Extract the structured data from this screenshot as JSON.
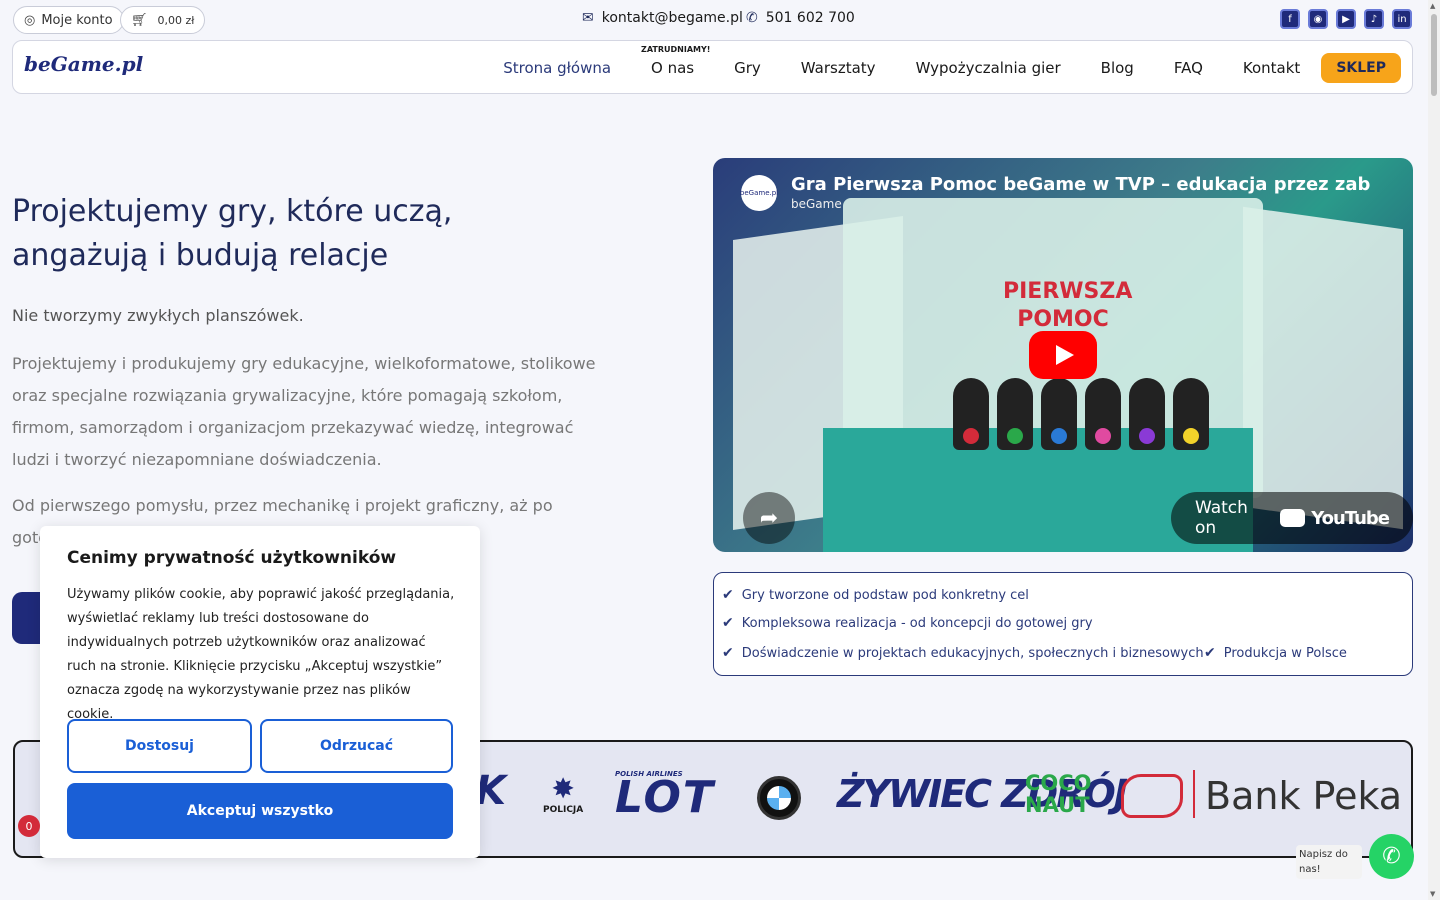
{
  "topbar": {
    "account_label": "Moje konto",
    "cart_label": "0,00 zł",
    "email": "kontakt@begame.pl",
    "phone": "501 602 700",
    "socials": [
      "facebook-icon",
      "instagram-icon",
      "youtube-icon",
      "tiktok-icon",
      "linkedin-icon"
    ]
  },
  "nav": {
    "logo": "beGame.pl",
    "items": [
      {
        "label": "Strona główna"
      },
      {
        "label": "O nas",
        "badge": "ZATRUDNIAMY!"
      },
      {
        "label": "Gry"
      },
      {
        "label": "Warsztaty"
      },
      {
        "label": "Wypożyczalnia gier"
      },
      {
        "label": "Blog"
      },
      {
        "label": "FAQ"
      },
      {
        "label": "Kontakt"
      }
    ],
    "shop_label": "SKLEP"
  },
  "hero": {
    "title": "Projektujemy gry, które uczą, angażują i budują relacje",
    "lead": "Nie tworzymy zwykłych planszówek.",
    "paragraph": "Projektujemy i produkujemy gry edukacyjne, wielkoformatowe, stolikowe oraz specjalne rozwiązania grywalizacyjne, które pomagają szkołom, firmom, samorządom i organizacjom przekazywać wiedzę, integrować ludzi i tworzyć niezapomniane doświadczenia.",
    "paragraph2": "Od pierwszego pomysłu, przez mechanikę i projekt graficzny, aż po gotową pro"
  },
  "video": {
    "title": "Gra Pierwsza Pomoc beGame w TVP – edukacja przez zabawę w",
    "channel": "beGame",
    "avatar_text": "beGame.pl",
    "board_text": "PIERWSZA POMOC",
    "watch_label": "Watch on",
    "yt_brand": "YouTube"
  },
  "features": [
    "Gry tworzone od podstaw pod konkretny cel",
    "Kompleksowa realizacja - od koncepcji do gotowej gry",
    "Doświadczenie w projektach edukacyjnych, społecznych i biznesowych",
    "Produkcja w Polsce"
  ],
  "logos": {
    "policja": "POLICJA",
    "lot_caption": "POLISH AIRLINES",
    "lot": "LOT",
    "zywiec": "ŻYWIEC ZDRÓJ",
    "coconaut": "COCO NAUT",
    "bank": "Bank Peka"
  },
  "cookie": {
    "title": "Cenimy prywatność użytkowników",
    "text": "Używamy plików cookie, aby poprawić jakość przeglądania, wyświetlać reklamy lub treści dostosowane do indywidualnych potrzeb użytkowników oraz analizować ruch na stronie. Kliknięcie przycisku „Akceptuj wszystkie” oznacza zgodę na wykorzystywanie przez nas plików cookie.",
    "customize": "Dostosuj",
    "reject": "Odrzucać",
    "accept": "Akceptuj wszystko"
  },
  "badge_count": "0",
  "whatsapp": {
    "label": "Napisz do nas!"
  },
  "colors": {
    "brand": "#1f2a7a",
    "accent": "#f7a41a",
    "cookie_blue": "#1a5fd6",
    "whatsapp": "#25d366"
  }
}
